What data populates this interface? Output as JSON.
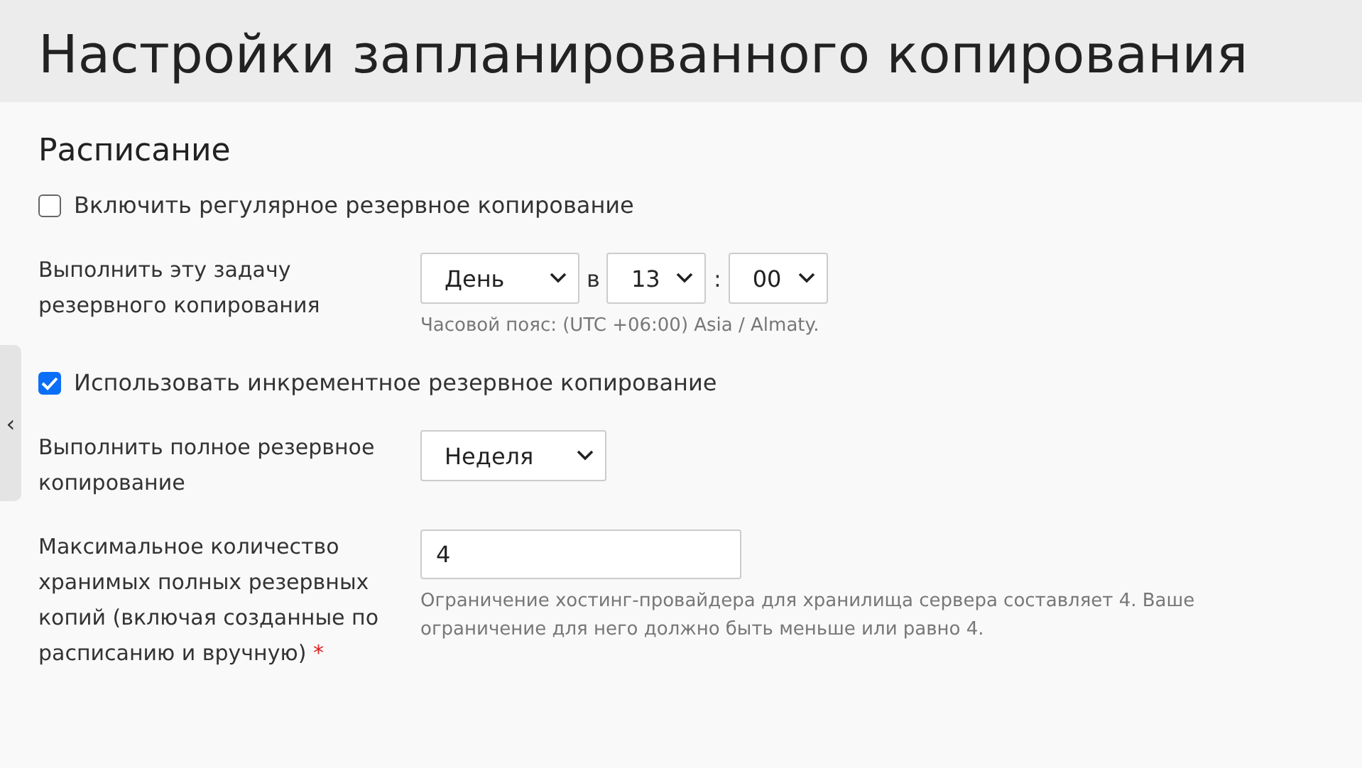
{
  "page_title": "Настройки запланированного копирования",
  "section_title": "Расписание",
  "collapse_toggle": "‹",
  "fields": [
    {
      "kind": "checkbox",
      "label": "Включить регулярное резервное копирование",
      "checked": false
    },
    {
      "kind": "schedule",
      "label": "Выполнить эту задачу резервного копирования",
      "period": "День",
      "at": "в",
      "hour": "13",
      "separator": ":",
      "minute": "00",
      "hint": "Часовой пояс: (UTC +06:00) Asia / Almaty."
    },
    {
      "kind": "checkbox",
      "label": "Использовать инкрементное резервное копирование",
      "checked": true
    },
    {
      "kind": "select",
      "label": "Выполнить полное резервное копирование",
      "value": "Неделя"
    },
    {
      "kind": "number",
      "label": "Максимальное количество хранимых полных резервных копий (включая созданные по расписанию и вручную)",
      "required_mark": "*",
      "value": "4",
      "hint": "Ограничение хостинг-провайдера для хранилища сервера составляет 4. Ваше ограничение для него должно быть меньше или равно 4."
    }
  ]
}
